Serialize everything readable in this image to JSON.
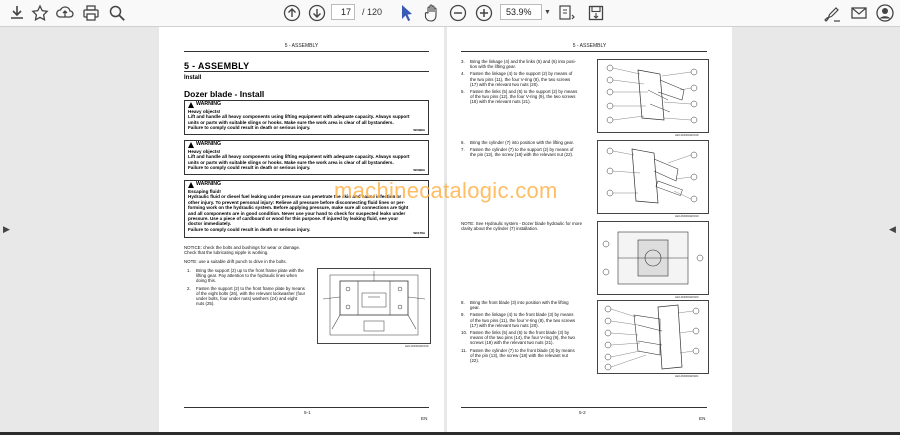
{
  "toolbar": {
    "page_current": "17",
    "page_total": "/ 120",
    "zoom": "53.9%",
    "icons": [
      "download-icon",
      "bookmark-icon",
      "upload-icon",
      "print-icon",
      "zoom-icon",
      "prev-page-icon",
      "next-page-icon",
      "select-icon",
      "hand-icon",
      "zoom-out-icon",
      "zoom-in-icon",
      "page-mode-icon",
      "save-icon",
      "sign-icon",
      "mail-icon",
      "account-icon"
    ]
  },
  "left_page": {
    "running_head": "5 - ASSEMBLY",
    "chapter": "5 - ASSEMBLY",
    "section": "Install",
    "topic": "Dozer blade - Install",
    "warnings": [
      {
        "head": "WARNING",
        "title": "Heavy objects!",
        "body": "Lift and handle all heavy components using lifting equipment with adequate capacity. Always support\nunits or parts with suitable slings or hooks. Make sure the work area is clear of all bystanders.\nFailure to comply could result in death or serious injury.",
        "code": "W0398A"
      },
      {
        "head": "WARNING",
        "title": "Heavy objects!",
        "body": "Lift and handle all heavy components using lifting equipment with adequate capacity. Always support\nunits or parts with suitable slings or hooks. Make sure the work area is clear of all bystanders.\nFailure to comply could result in death or serious injury.",
        "code": "W0398A"
      },
      {
        "head": "WARNING",
        "title": "Escaping fluid!",
        "body": "Hydraulic fluid or diesel fuel leaking under pressure can penetrate the skin and cause infection or\nother injury. To prevent personal injury: Relieve all pressure before disconnecting fluid lines or per-\nforming work on the hydraulic system. Before applying pressure, make sure all connections are tight\nand all components are in good condition. Never use your hand to check for suspected leaks under\npressure. Use a piece of cardboard or wood for this purpose. If injured by leaking fluid, see your\ndoctor immediately.\nFailure to comply could result in death or serious injury.",
        "code": "W0178A"
      }
    ],
    "notice1": "NOTICE: check the bolts and bushings for wear or damage.\nCheck that the lubricating nipple is working.",
    "notice2": "NOTE: use a suitable drift punch to drive in the bolts.",
    "steps": [
      {
        "n": "1.",
        "t": "Bring the support (2) up to the front frame plate with the\nlifting gear. Pay attention to the hydraulic lines when\ndoing this."
      },
      {
        "n": "2.",
        "t": "Fasten the support (2) to the front frame plate by means\nof the eight bolts (26), with the relevant lockwasher (four\nunder bolts, four under nuts) washers (24) and eight\nnuts (25)."
      }
    ],
    "fig_code": "LEIL06DRAW0016",
    "footer_page": "5-1",
    "footer_lang": "EN"
  },
  "right_page": {
    "running_head": "5 - ASSEMBLY",
    "steps_a": [
      {
        "n": "3.",
        "t": "Bring the linkage (4) and the links (5) and (6) into posi-\ntion with the lifting gear."
      },
      {
        "n": "4.",
        "t": "Fasten the linkage (4) to the support (2) by means of\nthe two pins (11), the four V-ring (8), the two screws\n(17) with the relevant two nuts (20)."
      },
      {
        "n": "5.",
        "t": "Fasten the links (5) and (6) to the support (2) by means\nof the two pins (12), the four V-ring (9), the two screws\n(18) with the relevant nuts (21)."
      }
    ],
    "steps_b": [
      {
        "n": "6.",
        "t": "Bring the cylinder (7) into position with the lifting gear."
      },
      {
        "n": "7.",
        "t": "Fasten the cylinder (7) to the support (2) by means of\nthe pin (13), the screw (18) with the relevant nut (22)."
      }
    ],
    "note_b": "NOTE: See Hydraulic system - Dozer blade hydraulic for more\nclarity about the cylinder (7) installation.",
    "steps_c": [
      {
        "n": "8.",
        "t": "Bring the front blade (3) into position with the lifting\ngear."
      },
      {
        "n": "9.",
        "t": "Fasten the linkage (4) to the front blade (3) by means\nof the two pins (11), the four V-ring (8), the two screws\n(17) with the relevant two nuts (20)."
      },
      {
        "n": "10.",
        "t": "Fasten the links (5) and (6) to the front blade (3) by\nmeans of the two pins (14), the four V-ring (9), the two\nscrews (19) with the relevant two nuts (21)."
      },
      {
        "n": "11.",
        "t": "Fasten the cylinder (7) to the front blade (3) by means\nof the pin (13), the screw (18) with the relevant nut\n(22)."
      }
    ],
    "fig_codes": [
      "LEIL06DRAW0018",
      "LEIL06DRAW0019",
      "LEIL06DRAW0020",
      "LEIL06DRAW0021"
    ],
    "footer_page": "5-2",
    "footer_lang": "EN"
  },
  "watermark": "machinecatalogic.com"
}
